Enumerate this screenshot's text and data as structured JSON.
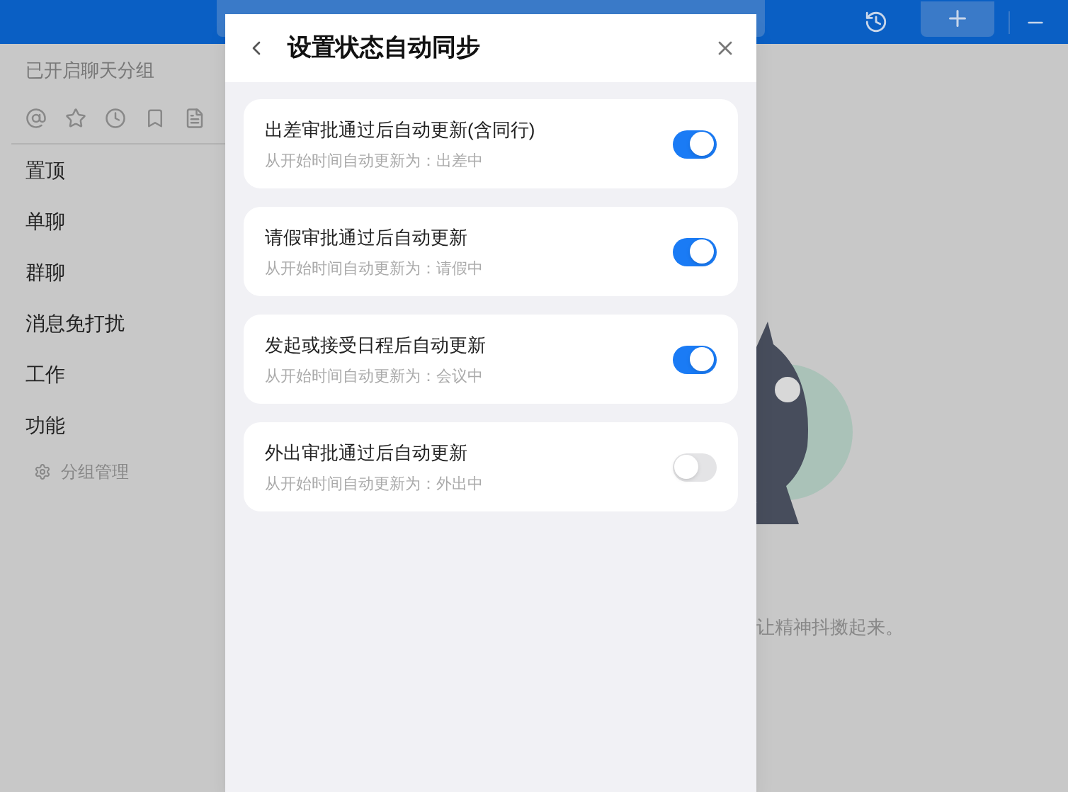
{
  "sidebar": {
    "header": "已开启聊天分组",
    "filter_icons": [
      {
        "kind": "at"
      },
      {
        "kind": "star"
      },
      {
        "kind": "recent"
      },
      {
        "kind": "bookmark"
      },
      {
        "kind": "file"
      }
    ],
    "items": [
      {
        "label": "置顶"
      },
      {
        "label": "单聊"
      },
      {
        "label": "群聊"
      },
      {
        "label": "消息免打扰"
      },
      {
        "label": "工作"
      },
      {
        "label": "功能"
      }
    ],
    "manage": "分组管理"
  },
  "background": {
    "slogan": "让精神抖擞起来。"
  },
  "dialog": {
    "title": "设置状态自动同步",
    "options": [
      {
        "label": "出差审批通过后自动更新(含同行)",
        "hint": "从开始时间自动更新为：出差中",
        "on": true
      },
      {
        "label": "请假审批通过后自动更新",
        "hint": "从开始时间自动更新为：请假中",
        "on": true
      },
      {
        "label": "发起或接受日程后自动更新",
        "hint": "从开始时间自动更新为：会议中",
        "on": true
      },
      {
        "label": "外出审批通过后自动更新",
        "hint": "从开始时间自动更新为：外出中",
        "on": false
      }
    ]
  }
}
